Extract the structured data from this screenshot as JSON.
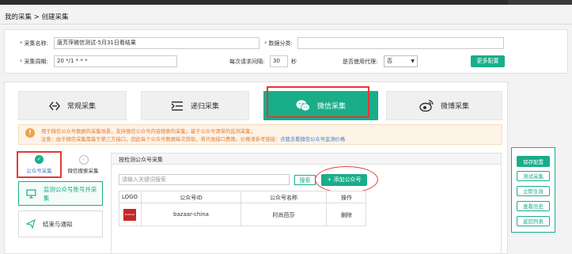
{
  "breadcrumb": "我的采集 > 创建采集",
  "form": {
    "name_label": "采集名称:",
    "name_value": "唐芳萍微信测试-5月31日看结果",
    "category_label": "数据分类:",
    "category_value": "",
    "period_label": "采集周期:",
    "period_value": "20 */1 * * *",
    "interval_label": "每次请求间隔:",
    "interval_value": "30",
    "interval_unit": "秒",
    "proxy_label": "是否使用代理:",
    "proxy_value": "否",
    "more_config": "更多配置"
  },
  "tabs": [
    {
      "label": "常规采集",
      "icon": "link-icon"
    },
    {
      "label": "递归采集",
      "icon": "list-icon"
    },
    {
      "label": "微信采集",
      "icon": "wechat-icon"
    },
    {
      "label": "微博采集",
      "icon": "weibo-icon"
    }
  ],
  "notice": {
    "line1": "用于微信公众号数据的采集场景，支持微信公众号内容搜索的采集；基于公众号清单的监测采集；",
    "line2": "注意：由于微信采集需基于第三方接口，因此每个公众号数据每次获取，将代收接口费用。价格请参考链接：",
    "link": "点我去看微信公众号监测价格"
  },
  "mode": {
    "account": "公众号采集",
    "search": "微信搜索采集"
  },
  "left_menu": [
    "监测公众号账号并采集",
    "结束与通知"
  ],
  "monitor": {
    "title": "按检测公众号采集",
    "search_placeholder": "请输入关键词搜索",
    "search_btn": "搜索",
    "add_btn": "+ 添加公众号",
    "columns": [
      "LOGO",
      "公众号ID",
      "公众号名称",
      "操作"
    ],
    "rows": [
      {
        "logo": "BAZAAR",
        "id": "bazaar-china",
        "name": "时尚芭莎",
        "action": "删除"
      }
    ]
  },
  "right_actions": [
    "保存配置",
    "测试采集",
    "立即生效",
    "查看历史",
    "返回列表"
  ],
  "colors": {
    "accent": "#1aad8a",
    "highlight": "#e53935",
    "notice": "#e07b39"
  }
}
